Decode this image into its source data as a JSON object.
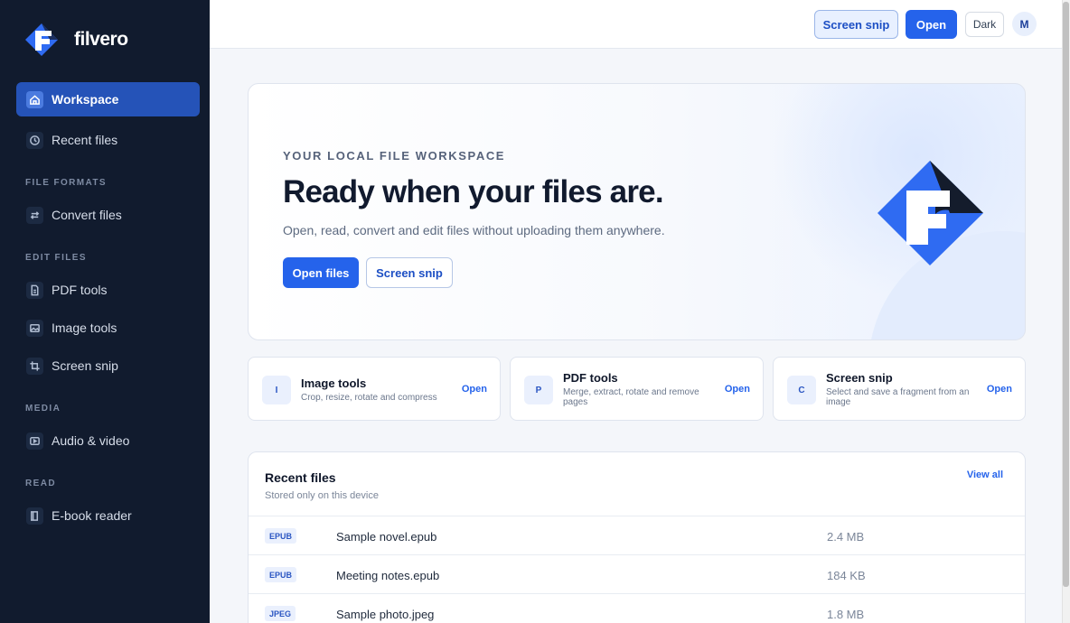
{
  "brand": {
    "name": "filvero",
    "logo_icon": "filvero-logo-icon"
  },
  "sidebar": {
    "items": [
      {
        "label": "Workspace",
        "icon": "home-icon",
        "active": true
      },
      {
        "label": "Recent files",
        "icon": "clock-icon"
      },
      {
        "label": "Convert files",
        "icon": "swap-arrows-icon"
      },
      {
        "label": "PDF tools",
        "icon": "document-icon"
      },
      {
        "label": "Image tools",
        "icon": "image-icon"
      },
      {
        "label": "Screen snip",
        "icon": "crop-icon"
      },
      {
        "label": "Audio & video",
        "icon": "play-icon"
      },
      {
        "label": "E-book reader",
        "icon": "book-icon"
      }
    ],
    "sections": [
      "FILE FORMATS",
      "EDIT FILES",
      "MEDIA",
      "READ"
    ]
  },
  "topbar": {
    "snip_label": "Screen snip",
    "open_label": "Open",
    "theme_label": "Dark",
    "avatar_initial": "M"
  },
  "hero": {
    "eyebrow": "YOUR LOCAL FILE WORKSPACE",
    "title": "Ready when your files are.",
    "subtitle": "Open, read, convert and edit files without uploading them anywhere.",
    "primary_label": "Open files",
    "secondary_label": "Screen snip"
  },
  "cards": [
    {
      "badge": "I",
      "title": "Image tools",
      "description": "Crop, resize, rotate and compress",
      "action": "Open"
    },
    {
      "badge": "P",
      "title": "PDF tools",
      "description": "Merge, extract, rotate and remove pages",
      "action": "Open"
    },
    {
      "badge": "C",
      "title": "Screen snip",
      "description": "Select and save a fragment from an image",
      "action": "Open"
    }
  ],
  "recent": {
    "title": "Recent files",
    "subtitle": "Stored only on this device",
    "view_all": "View all",
    "files": [
      {
        "type": "EPUB",
        "name": "Sample novel.epub",
        "size": "2.4 MB"
      },
      {
        "type": "EPUB",
        "name": "Meeting notes.epub",
        "size": "184 KB"
      },
      {
        "type": "JPEG",
        "name": "Sample photo.jpeg",
        "size": "1.8 MB"
      }
    ]
  },
  "colors": {
    "accent": "#2563eb",
    "sidebar_bg": "#111b2e",
    "active_nav": "#2553b8"
  }
}
